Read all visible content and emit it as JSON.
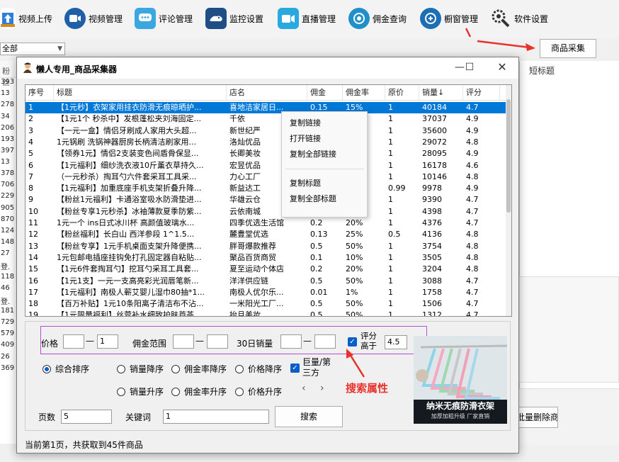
{
  "toolbar": {
    "items": [
      {
        "label": "视频上传",
        "icon": "upload-icon"
      },
      {
        "label": "视频管理",
        "icon": "video-icon"
      },
      {
        "label": "评论管理",
        "icon": "comment-icon"
      },
      {
        "label": "监控设置",
        "icon": "monitor-icon"
      },
      {
        "label": "直播管理",
        "icon": "live-icon"
      },
      {
        "label": "佣金查询",
        "icon": "commission-icon"
      },
      {
        "label": "橱窗管理",
        "icon": "showcase-icon"
      },
      {
        "label": "软件设置",
        "icon": "gear-icon"
      }
    ]
  },
  "main": {
    "filter_select": "全部",
    "collect_button": "商品采集",
    "left_header": "粉丝",
    "left_numbers": [
      "393",
      "13",
      "278",
      "34",
      "206",
      "193",
      "397",
      "13",
      "378",
      "706",
      "229",
      "905",
      "870",
      "124",
      "148",
      "27",
      "登.",
      "118",
      "46",
      "登.",
      "181",
      "729",
      "579",
      "409",
      "26",
      "369"
    ],
    "short_title_header": "短标题",
    "delete_button": "批量删除商品"
  },
  "dialog": {
    "title": "懒人专用_商品采集器",
    "columns": [
      "序号",
      "标题",
      "店名",
      "佣金",
      "佣金率",
      "原价",
      "销量↓",
      "评分"
    ],
    "rows": [
      [
        "1",
        "【1元秒】衣架家用挂衣防滑无痕晾晒护...",
        "喜地洁家居日...",
        "0.15",
        "15%",
        "1",
        "40184",
        "4.7"
      ],
      [
        "2",
        "【1元1个 秒杀中】发根蓬松夹刘海固定...",
        "千依",
        "",
        "%",
        "1",
        "37037",
        "4.9"
      ],
      [
        "3",
        "【一元一盒】情侣牙刷成人家用大头超...",
        "新世纪严",
        "",
        "%",
        "1",
        "35600",
        "4.9"
      ],
      [
        "4",
        "1元锅刷 洗锅神器厨房长柄清洁刷家用...",
        "洛灿优品",
        "",
        "%",
        "1",
        "29072",
        "4.8"
      ],
      [
        "5",
        "【领券1元】情侣2支装变色间盾骨保显...",
        "长卿美妆",
        "",
        "%",
        "1",
        "28095",
        "4.9"
      ],
      [
        "6",
        "【1元福利】细纱洗衣液10斤薰衣草持久...",
        "宏昱优品",
        "",
        "%",
        "1",
        "16178",
        "4.6"
      ],
      [
        "7",
        "（一元秒杀）掏耳勺六件套采耳工具采...",
        "力心工厂",
        "",
        "%",
        "1",
        "10146",
        "4.8"
      ],
      [
        "8",
        "【1元福利】加重底座手机支架折叠升降...",
        "新益达工",
        "",
        "%",
        "0.99",
        "9978",
        "4.9"
      ],
      [
        "9",
        "【粉丝1元福利】卡通浴室吸水防滑垫进...",
        "华雄云仓",
        "",
        "%",
        "1",
        "9390",
        "4.7"
      ],
      [
        "10",
        "【粉丝专享1元秒杀】冰袖薄款夏季防紫...",
        "云依南城",
        "",
        "%",
        "1",
        "4398",
        "4.7"
      ],
      [
        "11",
        "1元一个 ins日式冰川杯 高颜值玻璃水...",
        "四季优选生活馆",
        "0.2",
        "20%",
        "1",
        "4376",
        "4.7"
      ],
      [
        "12",
        "【粉丝福利】长白山  西洋参段 1^1.5...",
        "麓豊堂优选",
        "0.13",
        "25%",
        "0.5",
        "4136",
        "4.8"
      ],
      [
        "13",
        "【粉丝专享】1元手机桌面支架升降便携...",
        "胖哥爆款推荐",
        "0.5",
        "50%",
        "1",
        "3754",
        "4.8"
      ],
      [
        "14",
        "1元包邮电插座挂钩免打孔固定器自粘贴...",
        "聚品百货商贸",
        "0.1",
        "10%",
        "1",
        "3505",
        "4.8"
      ],
      [
        "15",
        "【1元6件套掏耳勺】挖耳勺采耳工具套...",
        "夏至运动个体店",
        "0.2",
        "20%",
        "1",
        "3204",
        "4.8"
      ],
      [
        "16",
        "【1元1支】一元一支高亮彩光润唇笔新...",
        "洋洋供应链",
        "0.5",
        "50%",
        "1",
        "3088",
        "4.7"
      ],
      [
        "17",
        "【1元福利】南极人蕲艾婴儿湿巾80抽*1...",
        "南极人优尔乐...",
        "0.01",
        "1%",
        "1",
        "1758",
        "4.7"
      ],
      [
        "18",
        "【百万补贴】1元10条阳离子清洁布不沾...",
        "一米阳光工厂...",
        "0.5",
        "50%",
        "1",
        "1506",
        "4.7"
      ],
      [
        "19",
        "【1元限量福利】丝蓉补水细致护肤芦荟...",
        "抬月美妆",
        "0.5",
        "50%",
        "1",
        "1312",
        "4.7"
      ]
    ],
    "context_menu": [
      "复制链接",
      "打开链接",
      "复制全部链接",
      "复制标题",
      "复制全部标题"
    ],
    "filters": {
      "price_label": "价格",
      "price_min": "",
      "price_max": "1",
      "commission_label": "佣金范围",
      "commission_min": "",
      "commission_max": "",
      "sales_label": "30日销量",
      "sales_min": "",
      "sales_max": "",
      "rating_label": "评分高于",
      "rating_value": "4.5",
      "dash": "—"
    },
    "sort": {
      "options": [
        "综合排序",
        "销量降序",
        "佣金率降序",
        "价格降序",
        "销量升序",
        "佣金率升序",
        "价格升序"
      ],
      "selected": "综合排序",
      "third_party_label": "巨量/第三方",
      "prev": "‹",
      "next": "›"
    },
    "pages_label": "页数",
    "pages_value": "5",
    "keyword_label": "关键词",
    "keyword_value": "1",
    "search_button": "搜索",
    "status": "当前第1页，共获取到45件商品",
    "ad": {
      "title": "纳米无痕防滑衣架",
      "subtitle": "加厚加粗升级 厂家直销"
    }
  },
  "annotation": {
    "label": "搜索属性",
    "color": "#e8322b"
  }
}
